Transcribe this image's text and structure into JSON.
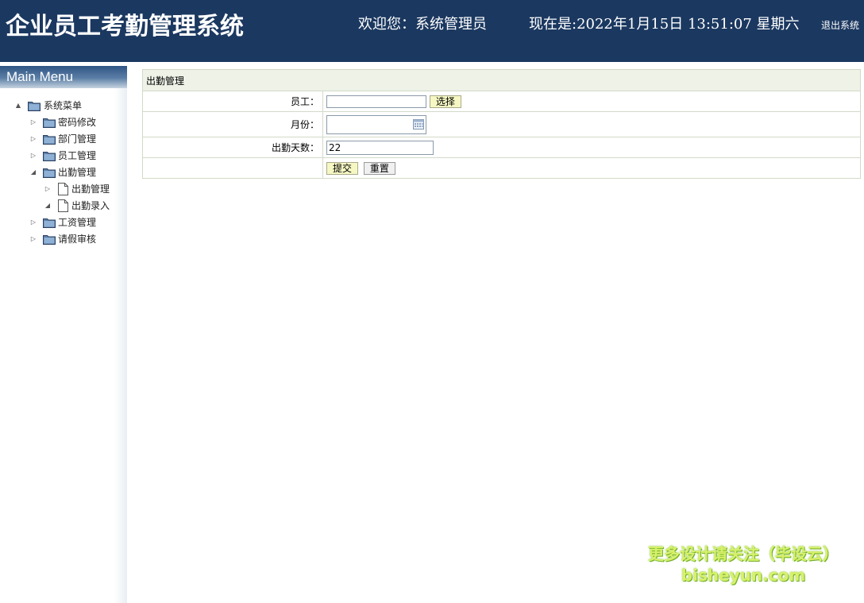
{
  "header": {
    "app_title": "企业员工考勤管理系统",
    "welcome": "欢迎您：系统管理员",
    "datetime": "现在是:2022年1月15日 13:51:07 星期六",
    "logout": "退出系统"
  },
  "sidebar": {
    "title": "Main Menu",
    "tree": [
      {
        "label": "系统菜单",
        "type": "folder",
        "expander": "▲"
      },
      {
        "label": "密码修改",
        "type": "folder",
        "expander": "▷"
      },
      {
        "label": "部门管理",
        "type": "folder",
        "expander": "▷"
      },
      {
        "label": "员工管理",
        "type": "folder",
        "expander": "▷"
      },
      {
        "label": "出勤管理",
        "type": "folder",
        "expander": "◢"
      },
      {
        "label": "出勤管理",
        "type": "file",
        "expander": "▷"
      },
      {
        "label": "出勤录入",
        "type": "file",
        "expander": "◢"
      },
      {
        "label": "工资管理",
        "type": "folder",
        "expander": "▷"
      },
      {
        "label": "请假审核",
        "type": "folder",
        "expander": "▷"
      }
    ]
  },
  "form": {
    "title": "出勤管理",
    "employee_label": "员工：",
    "employee_value": "",
    "select_button": "选择",
    "month_label": "月份：",
    "month_value": "",
    "days_label": "出勤天数：",
    "days_value": "22",
    "submit_button": "提交",
    "reset_button": "重置"
  },
  "watermark": {
    "line1": "更多设计请关注（毕设云）",
    "line2": "bisheyun.com"
  },
  "colors": {
    "header_bg": "#1b3860",
    "form_header_bg": "#eef2e7",
    "button_bg": "#f6f8c4",
    "watermark": "#d8f06b"
  }
}
